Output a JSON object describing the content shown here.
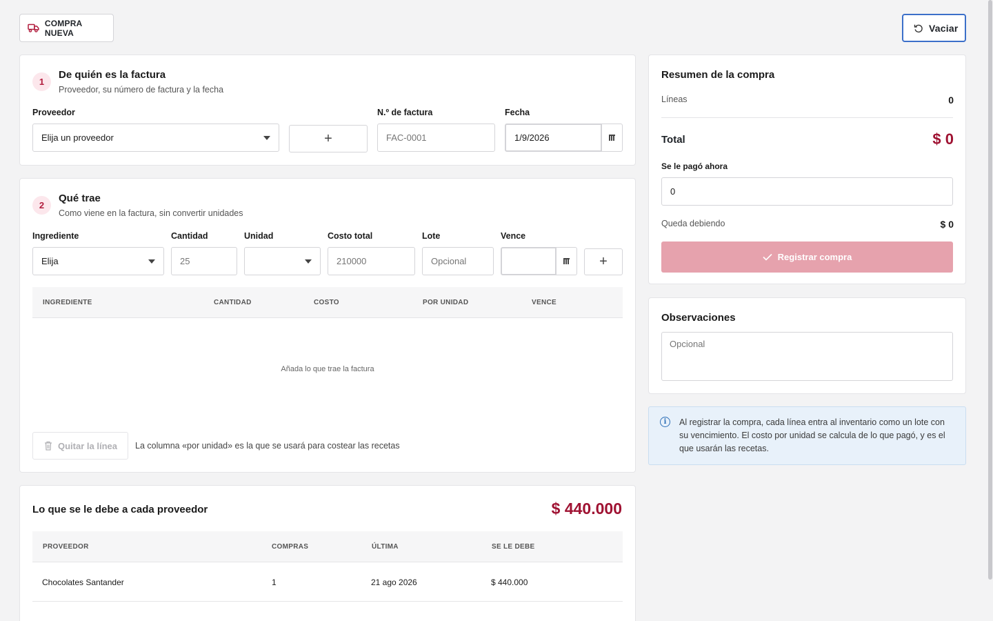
{
  "header": {
    "new_purchase_label": "COMPRA NUEVA",
    "new_purchase_icon": "truck-icon",
    "clear_label": "Vaciar",
    "clear_icon": "undo-icon"
  },
  "step1": {
    "number": "1",
    "title": "De quién es la factura",
    "subtitle": "Proveedor, su número de factura y la fecha",
    "provider_label": "Proveedor",
    "provider_value": "Elija un proveedor",
    "invoice_label": "N.º de factura",
    "invoice_placeholder": "FAC-0001",
    "date_label": "Fecha",
    "date_value": "1/9/2026"
  },
  "step2": {
    "number": "2",
    "title": "Qué trae",
    "subtitle": "Como viene en la factura, sin convertir unidades",
    "ingredient_label": "Ingrediente",
    "ingredient_value": "Elija",
    "quantity_label": "Cantidad",
    "quantity_placeholder": "25",
    "unit_label": "Unidad",
    "unit_value": "",
    "cost_label": "Costo total",
    "cost_placeholder": "210000",
    "lot_label": "Lote",
    "lot_placeholder": "Opcional",
    "expires_label": "Vence",
    "columns": [
      "INGREDIENTE",
      "CANTIDAD",
      "COSTO",
      "POR UNIDAD",
      "VENCE"
    ],
    "empty_message": "Añada lo que trae la factura",
    "remove_line_label": "Quitar la línea",
    "hint": "La columna «por unidad» es la que se usará para costear las recetas"
  },
  "debts": {
    "title": "Lo que se le debe a cada proveedor",
    "total": "$ 440.000",
    "columns": [
      "PROVEEDOR",
      "COMPRAS",
      "ÚLTIMA",
      "SE LE DEBE"
    ],
    "rows": [
      {
        "provider": "Chocolates Santander",
        "purchases": "1",
        "last": "21 ago 2026",
        "owed": "$ 440.000"
      }
    ]
  },
  "summary": {
    "title": "Resumen de la compra",
    "lines_label": "Líneas",
    "lines_value": "0",
    "total_label": "Total",
    "total_value": "$ 0",
    "paid_label": "Se le pagó ahora",
    "paid_value": "0",
    "owed_label": "Queda debiendo",
    "owed_value": "$ 0",
    "register_label": "Registrar compra"
  },
  "notes": {
    "title": "Observaciones",
    "placeholder": "Opcional"
  },
  "info": {
    "icon": "info-icon",
    "text": "Al registrar la compra, cada línea entra al inventario como un lote con su vencimiento. El costo por unidad se calcula de lo que pagó, y es el que usarán las recetas."
  },
  "colors": {
    "accent": "#9f1232",
    "button_disabled": "#e6a2ad",
    "focus_blue": "#3b6fc9",
    "info_bg": "#e8f1fa"
  }
}
